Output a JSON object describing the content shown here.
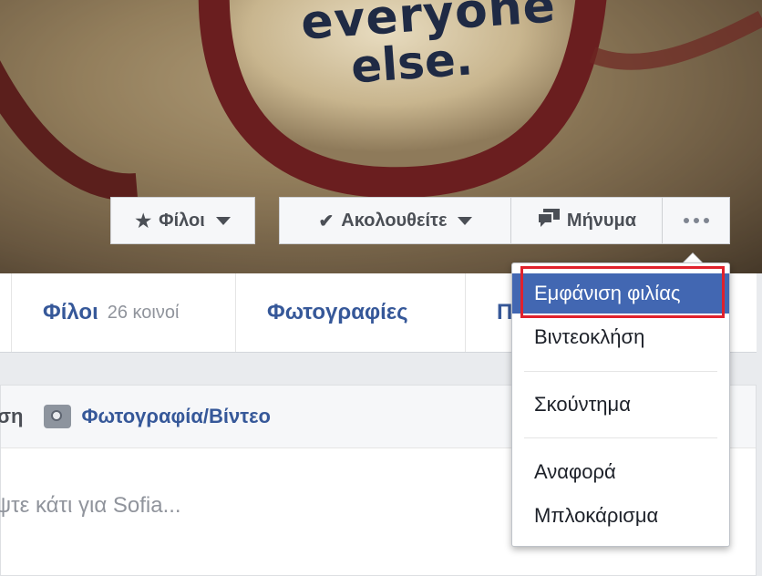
{
  "cover": {
    "text_line1": "everyone",
    "text_line2": "else."
  },
  "actions": {
    "friends_label": "Φίλοι",
    "following_label": "Ακολουθείτε",
    "message_label": "Μήνυμα"
  },
  "tabs": [
    {
      "label": "Φίλοι",
      "sub": "26 κοινοί"
    },
    {
      "label": "Φωτογραφίες",
      "sub": ""
    },
    {
      "label": "Π",
      "sub": ""
    }
  ],
  "composer": {
    "status_fragment": "ση",
    "photo_video_label": "Φωτογραφία/Βίντεο",
    "placeholder": "ψτε κάτι για Sofia..."
  },
  "menu": {
    "items": [
      {
        "label": "Εμφάνιση φιλίας",
        "active": true
      },
      {
        "label": "Βιντεοκλήση",
        "active": false
      },
      {
        "label": "Σκούντημα",
        "active": false
      },
      {
        "label": "Αναφορά",
        "active": false
      },
      {
        "label": "Μπλοκάρισμα",
        "active": false
      }
    ]
  },
  "colors": {
    "link_blue": "#365899",
    "menu_highlight": "#4267b2",
    "annotation_red": "#e0212c"
  }
}
